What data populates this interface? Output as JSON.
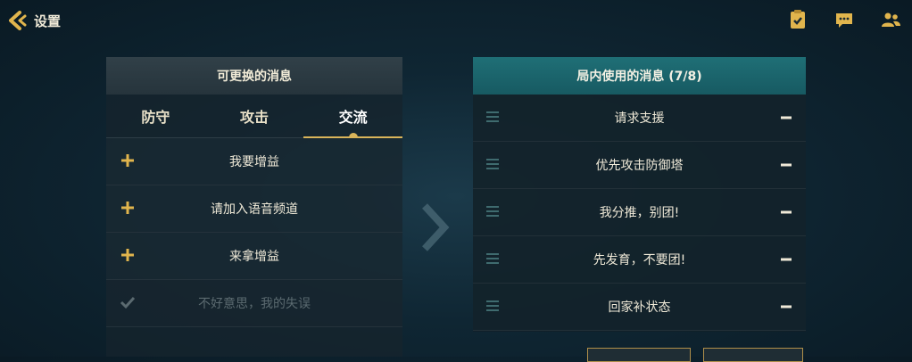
{
  "header": {
    "back_label": "设置"
  },
  "top_icons": [
    "checklist-icon",
    "chat-icon",
    "friends-icon"
  ],
  "left_panel": {
    "title": "可更换的消息",
    "tabs": [
      {
        "label": "防守",
        "active": false
      },
      {
        "label": "攻击",
        "active": false
      },
      {
        "label": "交流",
        "active": true
      }
    ],
    "items": [
      {
        "text": "我要增益",
        "state": "add"
      },
      {
        "text": "请加入语音频道",
        "state": "add"
      },
      {
        "text": "来拿增益",
        "state": "add"
      },
      {
        "text": "不好意思，我的失误",
        "state": "added"
      }
    ]
  },
  "right_panel": {
    "title": "局内使用的消息 (7/8)",
    "items": [
      {
        "text": "请求支援"
      },
      {
        "text": "优先攻击防御塔"
      },
      {
        "text": "我分推，别团!"
      },
      {
        "text": "先发育，不要团!"
      },
      {
        "text": "回家补状态"
      }
    ]
  },
  "colors": {
    "accent_gold": "#d9b45a",
    "accent_teal": "#1f6f76",
    "text": "#f0ead8",
    "disabled": "#5b6a70"
  }
}
